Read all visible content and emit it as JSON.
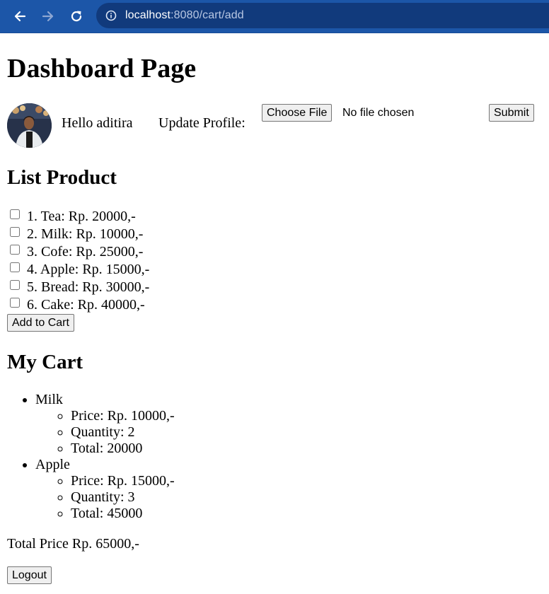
{
  "browser": {
    "url_host": "localhost",
    "url_rest": ":8080/cart/add"
  },
  "page": {
    "title": "Dashboard Page"
  },
  "profile": {
    "greeting": "Hello aditira",
    "update_label": "Update Profile:",
    "choose_file_label": "Choose File",
    "file_status": "No file chosen",
    "submit_label": "Submit"
  },
  "products": {
    "heading": "List Product",
    "items": [
      {
        "label": "1. Tea: Rp. 20000,-",
        "checked": false
      },
      {
        "label": "2. Milk: Rp. 10000,-",
        "checked": false
      },
      {
        "label": "3. Cofe: Rp. 25000,-",
        "checked": false
      },
      {
        "label": "4. Apple: Rp. 15000,-",
        "checked": false
      },
      {
        "label": "5. Bread: Rp. 30000,-",
        "checked": false
      },
      {
        "label": "6. Cake: Rp. 40000,-",
        "checked": false
      }
    ],
    "add_button_label": "Add to Cart"
  },
  "cart": {
    "heading": "My Cart",
    "items": [
      {
        "name": "Milk",
        "price": "Price: Rp. 10000,-",
        "quantity": "Quantity: 2",
        "total": "Total: 20000"
      },
      {
        "name": "Apple",
        "price": "Price: Rp. 15000,-",
        "quantity": "Quantity: 3",
        "total": "Total: 45000"
      }
    ],
    "total_price": "Total Price Rp. 65000,-"
  },
  "logout_label": "Logout",
  "icons": {
    "back": "arrow-left-icon",
    "forward": "arrow-right-icon",
    "reload": "reload-icon",
    "site_info": "info-icon"
  }
}
